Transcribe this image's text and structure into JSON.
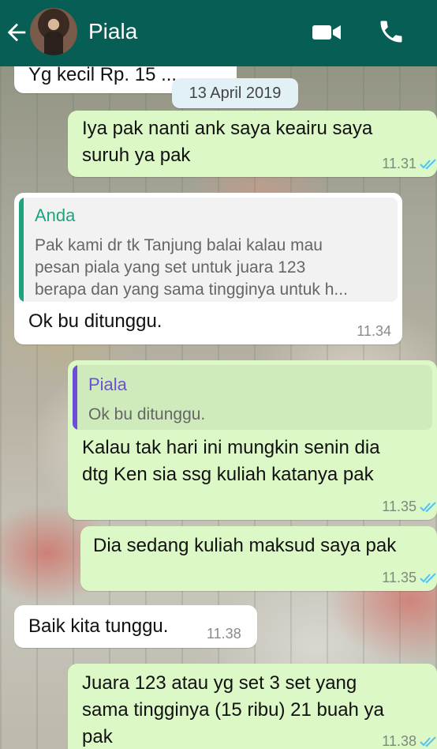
{
  "header": {
    "contact_name": "Piala",
    "back_icon": "back-arrow-icon",
    "video_icon": "video-call-icon",
    "call_icon": "phone-call-icon",
    "color": "#075e54"
  },
  "date_label": "13 April 2019",
  "messages": [
    {
      "id": "m0",
      "direction": "in",
      "text": "Yg kecil Rp. 15 ...",
      "time": ""
    },
    {
      "id": "m1",
      "direction": "out",
      "text": [
        "Iya pak nanti ank saya keairu saya",
        "suruh ya pak"
      ],
      "time": "11.31",
      "status": "read"
    },
    {
      "id": "m2",
      "direction": "in",
      "quote": {
        "author": "Anda",
        "text": [
          "Pak kami dr tk Tanjung balai kalau mau",
          "pesan piala yang set untuk juara 123",
          "berapa dan yang sama tingginya untuk h..."
        ]
      },
      "text": "Ok bu ditunggu.",
      "time": "11.34"
    },
    {
      "id": "m3",
      "direction": "out",
      "quote": {
        "author": "Piala",
        "text": "Ok bu ditunggu."
      },
      "text": [
        "Kalau tak hari ini mungkin senin dia",
        "dtg Ken sia ssg kuliah katanya pak"
      ],
      "time": "11.35",
      "status": "read"
    },
    {
      "id": "m4",
      "direction": "out",
      "text": "Dia sedang kuliah  maksud saya pak",
      "time": "11.35",
      "status": "read"
    },
    {
      "id": "m5",
      "direction": "in",
      "text": "Baik kita tunggu.",
      "time": "11.38"
    },
    {
      "id": "m6",
      "direction": "out",
      "text": [
        "Juara 123 atau yg set 3 set yang",
        "sama tingginya (15 ribu) 21 buah ya",
        "pak"
      ],
      "time": "11.38",
      "status": "read"
    }
  ],
  "colors": {
    "outgoing_bubble": "#dcf8c6",
    "incoming_bubble": "#ffffff",
    "read_ticks": "#4fc3f7",
    "quote_anda": "#1fa37f",
    "quote_piala": "#6b4fd8"
  }
}
